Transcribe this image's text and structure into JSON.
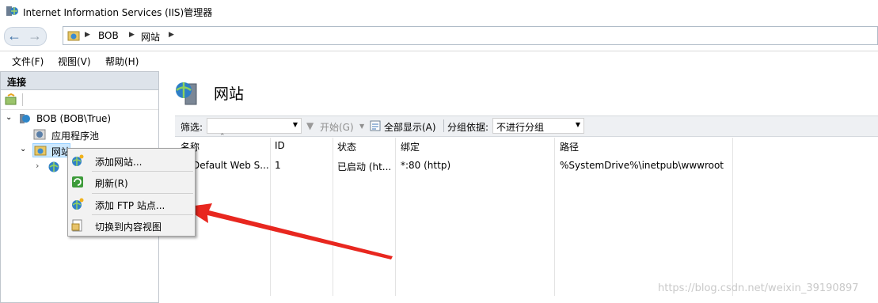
{
  "window": {
    "title": "Internet Information Services (IIS)管理器"
  },
  "address": {
    "crumbs": [
      "BOB",
      "网站"
    ]
  },
  "menu": {
    "items": [
      "文件(F)",
      "视图(V)",
      "帮助(H)"
    ]
  },
  "connections": {
    "header": "连接",
    "tree": {
      "server": "BOB (BOB\\True)",
      "app_pools": "应用程序池",
      "sites": "网站"
    }
  },
  "main": {
    "title": "网站",
    "filter_label": "筛选:",
    "start_label": "开始(G)",
    "show_all_label": "全部显示(A)",
    "group_by_label": "分组依据:",
    "group_by_value": "不进行分组",
    "columns": [
      "名称",
      "ID",
      "状态",
      "绑定",
      "路径"
    ],
    "rows": [
      [
        "Default Web S...",
        "1",
        "已启动 (ht...",
        "*:80 (http)",
        "%SystemDrive%\\inetpub\\wwwroot"
      ]
    ]
  },
  "context_menu": {
    "items": [
      "添加网站...",
      "刷新(R)",
      "添加 FTP 站点...",
      "切换到内容视图"
    ]
  },
  "watermark": "https://blog.csdn.net/weixin_39190897",
  "colors": {
    "arrow": "#e8271f",
    "header_bg": "#dde3ea"
  }
}
